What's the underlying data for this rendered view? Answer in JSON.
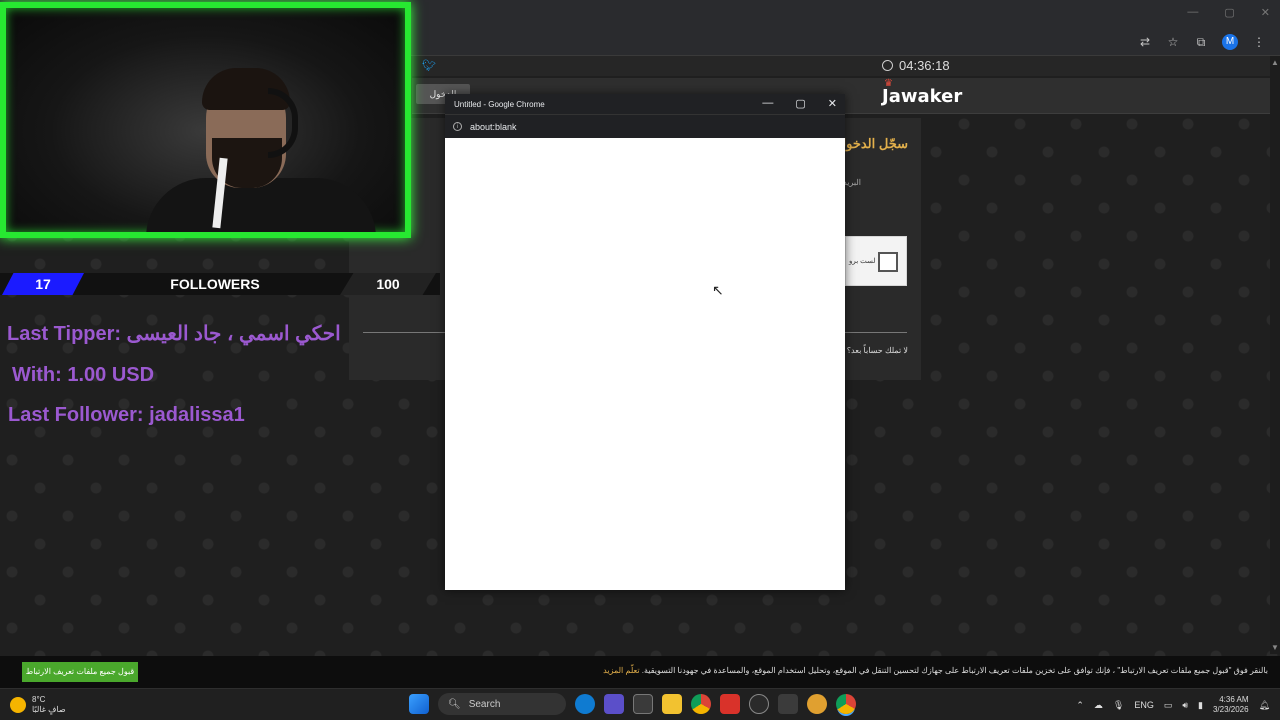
{
  "browser": {
    "window_controls": [
      "—",
      "▢",
      "✕"
    ],
    "clock_time": "04:36:18",
    "profile_initial": "M"
  },
  "site": {
    "logo": "Jawaker",
    "login_button": "الدخول",
    "panel_title": "سجّل الدخول",
    "email_label": "البريد",
    "captcha_label": "أنا لست برو",
    "no_account_text": "لا تملك حساباً بعد؟ ان"
  },
  "popup": {
    "title": "Untitled - Google Chrome",
    "url": "about:blank",
    "controls": [
      "—",
      "▢",
      "✕"
    ]
  },
  "stream_overlay": {
    "left_count": "17",
    "followers_label": "FOLLOWERS",
    "goal": "100",
    "last_tipper": "Last Tipper: احكي اسمي ، جاد العيسى",
    "tip_amount": "With: 1.00 USD",
    "last_follower": "Last Follower: jadalissa1"
  },
  "cookie_bar": {
    "accept_button": "قبول جميع ملفات تعريف الارتباط",
    "text": "بالنقر فوق \"قبول جميع ملفات تعريف الارتباط\" ، فإنك توافق على تخزين ملفات تعريف الارتباط على جهازك لتحسين التنقل في الموقع، وتحليل استخدام الموقع، والمساعدة في جهودنا التسويقية.",
    "link": "تعلّم المزيد"
  },
  "taskbar": {
    "weather_temp": "8°C",
    "weather_desc": "صافٍ غالبًا",
    "search_label": "Search",
    "language": "ENG",
    "time": "4:36 AM",
    "date": "3/23/2026"
  },
  "colors": {
    "webcam_border": "#27e831",
    "overlay_text": "#9b59d0",
    "followers_blue": "#1b1bff",
    "accent_gold": "#e3b04b",
    "cookie_green": "#4aa82c"
  }
}
